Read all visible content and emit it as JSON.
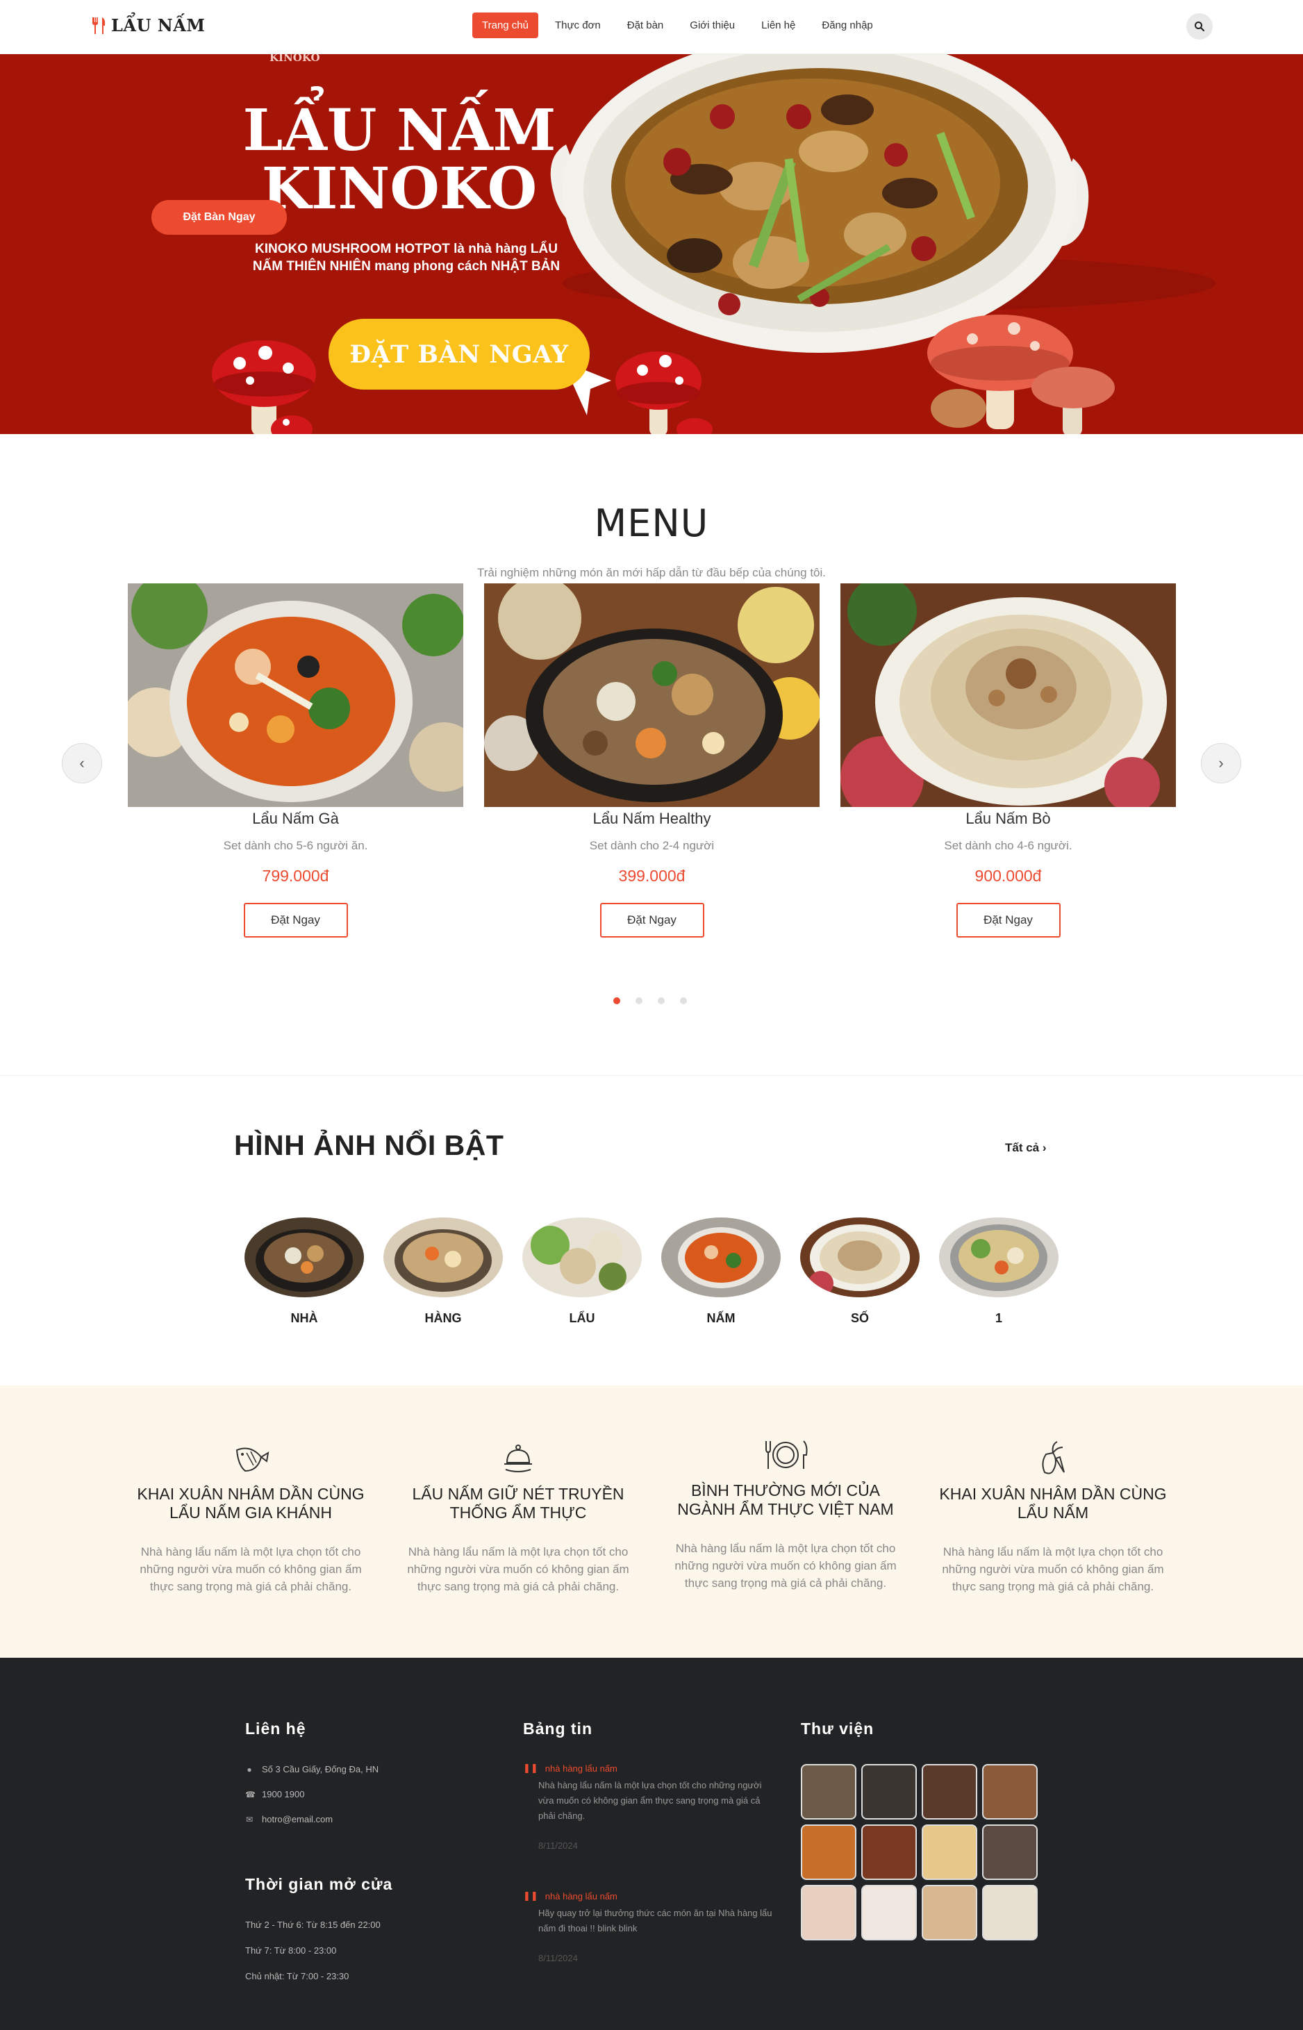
{
  "nav": {
    "logo": "LẨU NẤM",
    "items": [
      {
        "label": "Trang chủ",
        "active": true
      },
      {
        "label": "Thực đơn",
        "active": false
      },
      {
        "label": "Đặt bàn",
        "active": false
      },
      {
        "label": "Giới thiệu",
        "active": false
      },
      {
        "label": "Liên hệ",
        "active": false
      },
      {
        "label": "Đăng nhập",
        "active": false
      }
    ],
    "search_icon": "search-icon"
  },
  "hero": {
    "brand_small": "KINOKO",
    "title_line1": "LẨU NẤM",
    "title_line2": "KINOKO",
    "small_button": "Đặt Bàn Ngay",
    "description": "KINOKO MUSHROOM HOTPOT là nhà hàng LẨU NẤM THIÊN NHIÊN mang phong cách NHẬT BẢN",
    "big_button": "ĐẶT BÀN NGAY",
    "bg_color": "#a41507",
    "button_color": "#fbc21c"
  },
  "menu": {
    "title": "MENU",
    "subtitle": "Trải nghiệm những món ăn mới hấp dẫn từ đầu bếp của chúng tôi.",
    "cards": [
      {
        "name": "Lẩu Nấm Gà",
        "desc": "Set dành cho 5-6 người ăn.",
        "price": "799.000đ",
        "button": "Đặt Ngay"
      },
      {
        "name": "Lẩu Nấm Healthy",
        "desc": "Set dành cho 2-4 người",
        "price": "399.000đ",
        "button": "Đặt Ngay"
      },
      {
        "name": "Lẩu Nấm Bò",
        "desc": "Set dành cho 4-6 người.",
        "price": "900.000đ",
        "button": "Đặt Ngay"
      }
    ],
    "prev_icon": "chevron-left-icon",
    "next_icon": "chevron-right-icon",
    "pagination": {
      "pages": 4,
      "active": 1
    }
  },
  "gallery": {
    "title": "HÌNH ẢNH NỔI BẬT",
    "all_link": "Tất cả",
    "items": [
      "NHÀ",
      "HÀNG",
      "LẨU",
      "NẤM",
      "SỐ",
      "1"
    ]
  },
  "features": [
    {
      "icon": "fish-icon",
      "title": "KHAI XUÂN NHÂM DẦN CÙNG LẨU NẤM GIA KHÁNH",
      "text": "Nhà hàng lẩu nấm là một lựa chọn tốt cho những người vừa muốn có không gian ấm thực sang trọng mà giá cả phải chăng."
    },
    {
      "icon": "cloche-icon",
      "title": "LẨU NẤM GIỮ NÉT TRUYỀN THỐNG ẨM THỰC",
      "text": "Nhà hàng lẩu nấm là một lựa chọn tốt cho những người vừa muốn có không gian ấm thực sang trọng mà giá cả phải chăng."
    },
    {
      "icon": "plate-cutlery-icon",
      "title": "BÌNH THƯỜNG MỚI CỦA NGÀNH ẨM THỰC VIỆT NAM",
      "text": "Nhà hàng lẩu nấm là một lựa chọn tốt cho những người vừa muốn có không gian ấm thực sang trọng mà giá cả phải chăng."
    },
    {
      "icon": "vegetables-icon",
      "title": "KHAI XUÂN NHÂM DẦN CÙNG LẨU NẤM",
      "text": "Nhà hàng lẩu nấm là một lựa chọn tốt cho những người vừa muốn có không gian ấm thực sang trọng mà giá cả phải chăng."
    }
  ],
  "footer": {
    "contact": {
      "title": "Liên hệ",
      "address": "Số 3 Cầu Giấy, Đống Đa, HN",
      "phone": "1900 1900",
      "email": "hotro@email.com"
    },
    "hours": {
      "title": "Thời gian mở cửa",
      "rows": [
        "Thứ 2 - Thứ 6: Từ 8:15 đến 22:00",
        "Thứ 7: Từ 8:00 - 23:00",
        "Chủ nhật: Từ 7:00 - 23:30"
      ]
    },
    "news": {
      "title": "Bảng tin",
      "items": [
        {
          "tag": "nhà hàng lẩu nấm",
          "text": "Nhà hàng lẩu nấm là một lựa chọn tốt cho những người vừa muốn có không gian ẩm thực sang trọng mà giá cả phải chăng.",
          "date": "8/11/2024"
        },
        {
          "tag": "nhà hàng lẩu nấm",
          "text": "Hãy quay trở lại thưởng thức các món ăn tại Nhà hàng lẩu nấm đi thoai !! blink blink",
          "date": "8/11/2024"
        }
      ]
    },
    "library": {
      "title": "Thư viện",
      "count": 12
    }
  }
}
